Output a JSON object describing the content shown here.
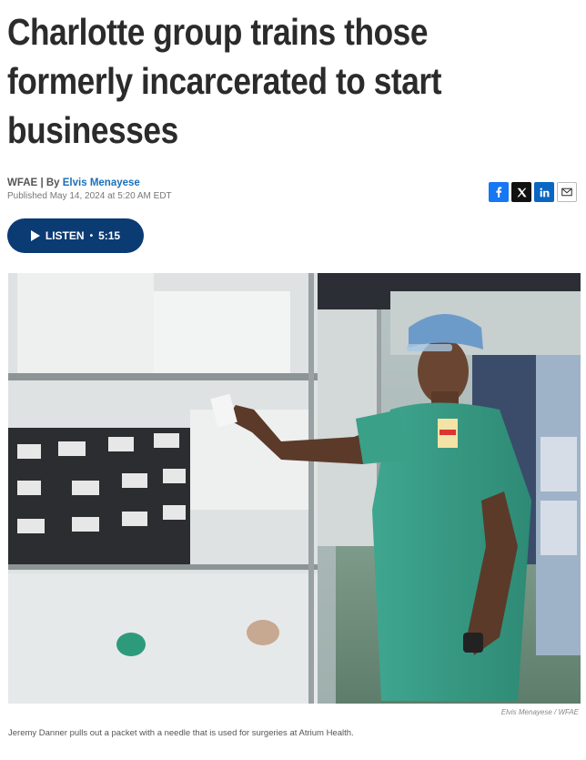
{
  "article": {
    "headline": "Charlotte group trains those formerly incarcerated to start businesses",
    "byline": {
      "source": "WFAE",
      "separator": "|",
      "by_prefix": "By",
      "author": "Elvis Menayese",
      "published": "Published May 14, 2024 at 5:20 AM EDT"
    },
    "share": [
      {
        "name": "facebook",
        "icon": "facebook-icon",
        "glyph": "f"
      },
      {
        "name": "x",
        "icon": "x-icon",
        "glyph": "𝕏"
      },
      {
        "name": "linkedin",
        "icon": "linkedin-icon",
        "glyph": "in"
      },
      {
        "name": "email",
        "icon": "mail-icon",
        "glyph": ""
      }
    ],
    "listen": {
      "label": "LISTEN",
      "separator": "•",
      "duration": "5:15"
    },
    "image": {
      "credit": "Elvis Menayese / WFAE",
      "caption": "Jeremy Danner pulls out a packet with a needle that is used for surgeries at Atrium Health."
    }
  },
  "colors": {
    "headline": "#2b2b2b",
    "author_link": "#1d6fb8",
    "listen_button": "#0b3b73",
    "facebook": "#1877f2",
    "x": "#111111",
    "linkedin": "#0a66c2"
  }
}
